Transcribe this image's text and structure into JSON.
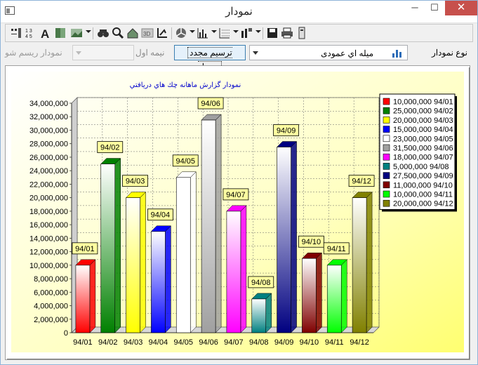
{
  "window": {
    "title": "نمودار",
    "minimize": "─",
    "maximize": "☐",
    "close": "✕"
  },
  "toolbar": {
    "buttons": [
      "data-labels-icon",
      "data-table-icon",
      "font-icon",
      "background-color-icon",
      "gallery-icon",
      "binoculars-icon",
      "zoom-icon",
      "three-d-rotate-icon",
      "three-d-icon",
      "axis-icon",
      "pie-tools-icon",
      "bar-tools-icon",
      "grid-icon",
      "legend-icon",
      "save-icon",
      "print-icon",
      "copy-icon"
    ]
  },
  "options": {
    "chart_type_label": "نوع نمودار",
    "chart_type_value": "میله اي عمودی",
    "redraw_label": "ترسیم مجدد نمودار",
    "half_label": "نیمه اول",
    "method_label": "نمودار ریسم شو"
  },
  "colors": {
    "bg_top": "#ffffff",
    "bg_bottom": "#ffff80",
    "title_color": "#0000cc"
  },
  "chart_data": {
    "type": "bar",
    "title": "نمودار گزارش ماهانه چك  هاي دريافتي",
    "categories": [
      "94/01",
      "94/02",
      "94/03",
      "94/04",
      "94/05",
      "94/06",
      "94/07",
      "94/08",
      "94/09",
      "94/10",
      "94/11",
      "94/12"
    ],
    "values": [
      10000000,
      25000000,
      20000000,
      15000000,
      23000000,
      31500000,
      18000000,
      5000000,
      27500000,
      11000000,
      10000000,
      20000000
    ],
    "colors": [
      "#ff0000",
      "#008000",
      "#ffff00",
      "#0000ff",
      "#ffffff",
      "#a0a0a0",
      "#ff00ff",
      "#008080",
      "#000080",
      "#800000",
      "#00ff00",
      "#808000"
    ],
    "data_labels": [
      "94/01",
      "94/02",
      "94/03",
      "94/04",
      "94/05",
      "94/06",
      "94/07",
      "94/08",
      "94/09",
      "94/10",
      "94/11",
      "94/12"
    ],
    "legend": [
      "10,000,000 94/01",
      "25,000,000 94/02",
      "20,000,000 94/03",
      "15,000,000 94/04",
      "23,000,000 94/05",
      "31,500,000 94/06",
      "18,000,000 94/07",
      "5,000,000 94/08",
      "27,500,000 94/09",
      "11,000,000 94/10",
      "10,000,000 94/11",
      "20,000,000 94/12"
    ],
    "legend_position": "right",
    "yticks": [
      "0",
      "2,000,000",
      "4,000,000",
      "6,000,000",
      "8,000,000",
      "10,000,000",
      "12,000,000",
      "14,000,000",
      "16,000,000",
      "18,000,000",
      "20,000,000",
      "22,000,000",
      "24,000,000",
      "26,000,000",
      "28,000,000",
      "30,000,000",
      "32,000,000",
      "34,000,000"
    ],
    "ylim": [
      0,
      34000000
    ],
    "grid": true
  }
}
